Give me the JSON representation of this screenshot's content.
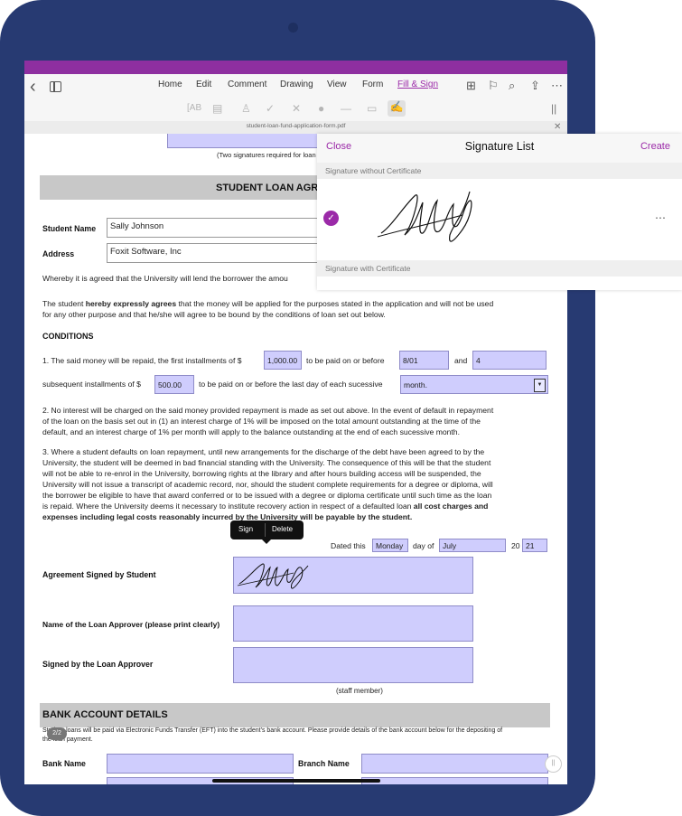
{
  "menu": {
    "items": [
      "Home",
      "Edit",
      "Comment",
      "Drawing",
      "View",
      "Form",
      "Fill & Sign"
    ],
    "active": "Fill & Sign"
  },
  "tools": [
    "text-field-icon",
    "comb-field-icon",
    "stamp-icon",
    "checkmark-icon",
    "cross-icon",
    "dot-icon",
    "line-icon",
    "rectangle-icon",
    "signature-icon"
  ],
  "file": {
    "name": "student-loan-fund-application-form.pdf"
  },
  "document": {
    "top_note": "(Two signatures required for loan",
    "title": "STUDENT LOAN AGRE",
    "student_name_label": "Student Name",
    "student_name_value": "Sally Johnson",
    "address_label": "Address",
    "address_value": "Foxit Software, Inc",
    "whereby": "Whereby it is agreed that the University will lend the borrower the amou",
    "agrees_line1_pre": "The student ",
    "agrees_line1_bold": "hereby expressly agrees",
    "agrees_line1_post": " that the money will be applied for the purposes stated in the application and will not be used",
    "agrees_line2": "for any other purpose and that he/she will agree to be bound by the conditions of loan set out below.",
    "conditions_heading": "CONDITIONS",
    "c1_a": "1. The said money will be repaid, the first installments of $",
    "c1_amount": "1,000.00",
    "c1_b": "to be paid on or before",
    "c1_date": "8/01",
    "c1_and": "and",
    "c1_count": "4",
    "c1_c": "subsequent installments of $",
    "c1_amount2": "500.00",
    "c1_d": "to be paid on or before the last day of each sucessive",
    "c1_period": "month.",
    "c2_l1": "2. No interest will be charged on the said money provided repayment is made as set out above.  In the event of default in repayment",
    "c2_l2": "of the loan on the basis set out in (1) an interest charge of 1% will be imposed on the total amount outstanding at the time of the",
    "c2_l3": "default, and an interest charge of 1% per month will apply to the balance outstanding at the end of each sucessive month.",
    "c3_l1": "3. Where a student defaults on loan repayment, until new arrangements for the discharge of the debt have been agreed to by the",
    "c3_l2": "University, the student will be deemed in bad financial standing with the University. The consequence of this will be that the student",
    "c3_l3": "will not be able to re-enrol in the University, borrowing rights at the library and after hours building access will be suspended, the",
    "c3_l4": "University will not issue a transcript of academic record, nor, should the student complete requirements for a degree or diploma, will",
    "c3_l5": "the borrower be eligible to have that award conferred or to be issued with a degree or diploma certificate until such time as the loan",
    "c3_l6_pre": "is repaid. Where the University deems it necessary to institute recovery action in respect of a defaulted loan ",
    "c3_l6_bold": "all cost charges and",
    "c3_l7": "expenses including legal costs reasonably incurred by the University will be payable by the student.",
    "popup_sign": "Sign",
    "popup_delete": "Delete",
    "dated_this": "Dated this",
    "dated_day": "Monday",
    "day_of": "day of",
    "dated_month": "July",
    "year_prefix": "20",
    "year_value": "21",
    "agreement_label": "Agreement Signed by Student",
    "approver_name_label": "Name of the Loan Approver (please print clearly)",
    "approver_signed_label": "Signed by the Loan Approver",
    "staff_member": "(staff member)",
    "bank_heading": "BANK ACCOUNT DETAILS",
    "bank_text_l1": "Student loans will be paid via Electronic Funds Transfer (EFT) into the student's bank account.  Please provide details of the bank account below for the depositing of",
    "bank_text_l2": "the loan payment.",
    "bank_name_label": "Bank Name",
    "branch_name_label": "Branch Name"
  },
  "signature_panel": {
    "close": "Close",
    "title": "Signature List",
    "create": "Create",
    "without_cert": "Signature without Certificate",
    "with_cert": "Signature with Certificate"
  },
  "page_indicator": "2/2"
}
